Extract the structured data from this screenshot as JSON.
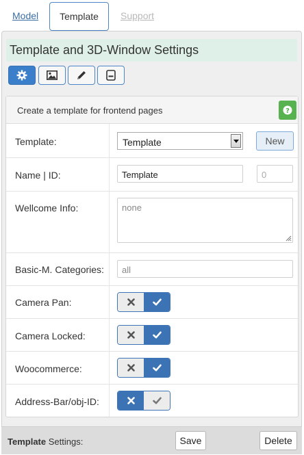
{
  "tabs": {
    "model": "Model",
    "template": "Template",
    "support": "Support"
  },
  "header": {
    "title": "Template and 3D-Window Settings"
  },
  "toolbar_icons": [
    "gear-icon",
    "image-icon",
    "pencil-icon",
    "window-icon"
  ],
  "card": {
    "heading": "Create a template for frontend pages",
    "help_icon": "question-icon"
  },
  "fields": {
    "template": {
      "label": "Template:",
      "value": "Template",
      "new_label": "New"
    },
    "name_id": {
      "label": "Name | ID:",
      "name_value": "Template",
      "id_placeholder": "0"
    },
    "welcome": {
      "label": "Wellcome Info:",
      "placeholder": "none"
    },
    "categories": {
      "label": "Basic-M. Categories:",
      "placeholder": "all"
    },
    "camera_pan": {
      "label": "Camera Pan:",
      "value": "on"
    },
    "camera_locked": {
      "label": "Camera Locked:",
      "value": "on"
    },
    "woocommerce": {
      "label": "Woocommerce:",
      "value": "on"
    },
    "address_bar": {
      "label": "Address-Bar/obj-ID:",
      "value": "off"
    }
  },
  "footer": {
    "bold": "Template",
    "rest": " Settings:",
    "save": "Save",
    "delete": "Delete"
  },
  "colors": {
    "accent": "#3b73b5",
    "header_bg": "#dff0e8",
    "help": "#57b24f"
  }
}
